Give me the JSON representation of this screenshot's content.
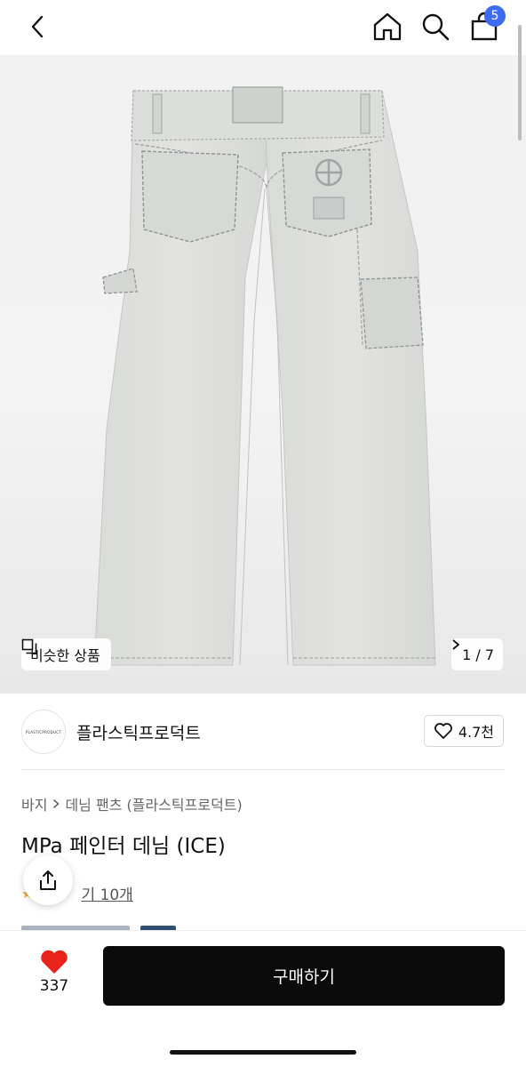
{
  "header": {
    "back_icon": "chevron-left-icon",
    "home_icon": "home-icon",
    "search_icon": "search-icon",
    "cart_icon": "shopping-bag-icon",
    "cart_count": "5",
    "badge_color": "#3d6cf0"
  },
  "gallery": {
    "image_subject": "light grey carpenter denim pants, back view",
    "similar_label": "비슷한 상품",
    "counter": "1 / 7"
  },
  "brand": {
    "logo_text": "PLASTICPRODUCT",
    "name": "플라스틱프로덕트",
    "favorites": "4.7천"
  },
  "product": {
    "breadcrumb": [
      "바지",
      "데님 팬츠 (플라스틱프로덕트)"
    ],
    "title": "MPa 페인터 데님 (ICE)",
    "review_text": "후기 10개",
    "review_partial": "기 10개"
  },
  "bottom_bar": {
    "like_count": "337",
    "like_color": "#e8231c",
    "buy_label": "구매하기"
  }
}
